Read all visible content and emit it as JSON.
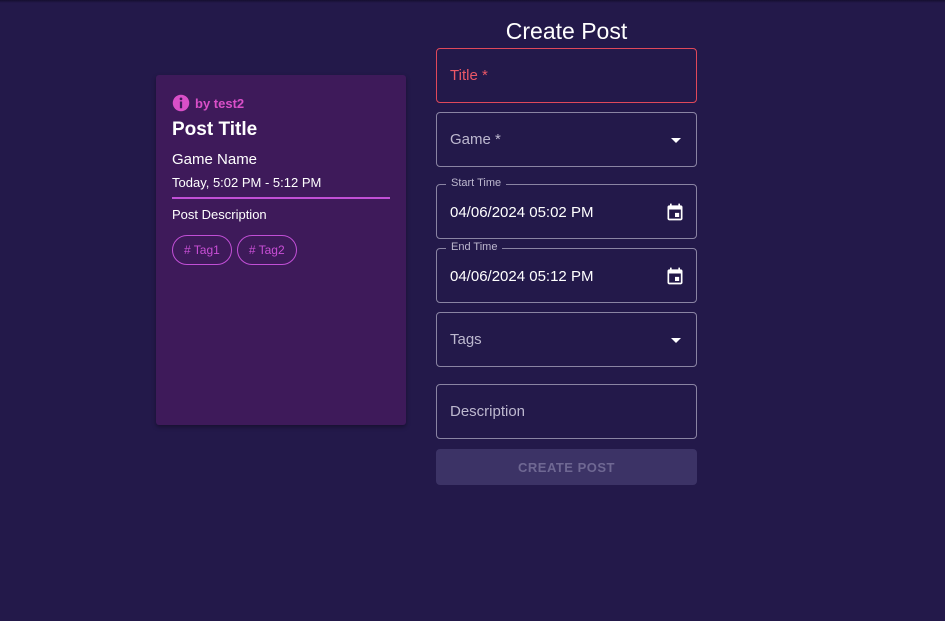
{
  "preview": {
    "author": "by test2",
    "title": "Post Title",
    "game": "Game Name",
    "time": "Today, 5:02 PM - 5:12 PM",
    "description": "Post Description",
    "tags": [
      "# Tag1",
      "# Tag2"
    ]
  },
  "form": {
    "heading": "Create Post",
    "title_placeholder": "Title *",
    "game_placeholder": "Game *",
    "start_label": "Start Time",
    "start_value": "04/06/2024 05:02 PM",
    "end_label": "End Time",
    "end_value": "04/06/2024 05:12 PM",
    "tags_placeholder": "Tags",
    "description_placeholder": "Description",
    "submit_label": "CREATE POST"
  },
  "icons": {
    "info": "info-icon",
    "calendar": "calendar-icon",
    "dropdown": "arrow-drop-down-icon"
  },
  "colors": {
    "background": "#23194a",
    "card": "#3e1a5a",
    "accent": "#d94fc8",
    "error": "#e0485a"
  }
}
